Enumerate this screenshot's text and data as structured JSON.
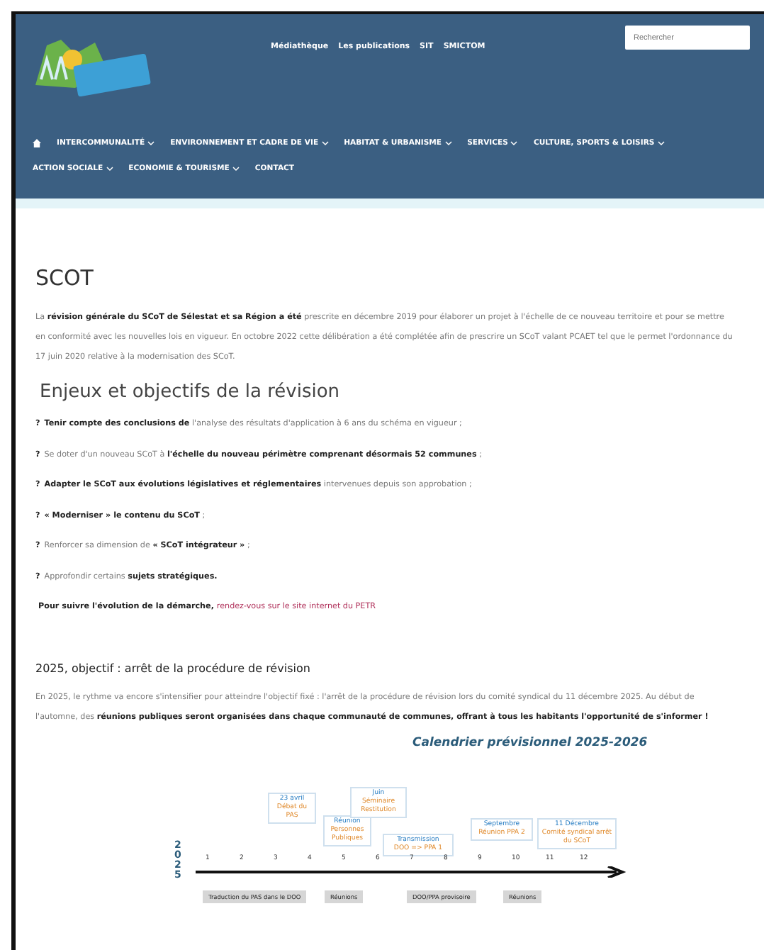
{
  "header": {
    "top_links": [
      "Médiathèque",
      "Les publications",
      "SIT",
      "SMICTOM"
    ],
    "search": {
      "placeholder": "Rechercher"
    },
    "nav": [
      {
        "label": "INTERCOMMUNALITÉ",
        "submenu": true
      },
      {
        "label": "ENVIRONNEMENT ET CADRE DE VIE",
        "submenu": true
      },
      {
        "label": "HABITAT & URBANISME",
        "submenu": true
      },
      {
        "label": "SERVICES",
        "submenu": true
      },
      {
        "label": "CULTURE, SPORTS & LOISIRS",
        "submenu": true
      },
      {
        "label": "ACTION SOCIALE",
        "submenu": true
      },
      {
        "label": "ECONOMIE & TOURISME",
        "submenu": true
      },
      {
        "label": "CONTACT",
        "submenu": false
      }
    ]
  },
  "page_title": "SCOT",
  "intro": "La **révision générale du SCoT de Sélestat et sa Région a été** prescrite en décembre 2019 pour élaborer un projet à l'échelle de ce nouveau territoire et pour se mettre en conformité avec les nouvelles lois en vigueur. En octobre 2022 cette délibération a été complétée afin de prescrire un SCoT valant PCAET tel que le permet l'ordonnance du 17 juin 2020 relative à la modernisation des SCoT.",
  "section_title": "Enjeux et objectifs de la révision",
  "objectives": [
    {
      "marker": "?",
      "text": "**Tenir compte des conclusions de** l'analyse des résultats d'application à 6 ans du schéma en vigueur ;"
    },
    {
      "marker": "?",
      "text": "Se doter d'un nouveau SCoT à **l'échelle du nouveau périmètre comprenant désormais 52 communes** ;"
    },
    {
      "marker": "?",
      "text": "**Adapter le SCoT aux évolutions législatives et réglementaires** intervenues depuis son approbation ;"
    },
    {
      "marker": "?",
      "text": "**« Moderniser » le contenu du SCoT** ;"
    },
    {
      "marker": "?",
      "text": "Renforcer sa dimension de **« SCoT intégrateur »** ;"
    },
    {
      "marker": "?",
      "text": "Approfondir certains **sujets stratégiques.**"
    }
  ],
  "follow": {
    "text": "Pour suivre l'évolution de la démarche,",
    "link": "rendez-vous sur le site internet du PETR"
  },
  "subsection_title": "2025, objectif : arrêt de la procédure de révision",
  "outlook": "En 2025, le rythme va encore s'intensifier pour atteindre l'objectif fixé : l'arrêt de la procédure de révision lors du comité syndical du 11 décembre 2025. Au début de l'automne, des **réunions publiques seront organisées dans chaque communauté de communes, offrant à tous les habitants l'opportunité de s'informer !**",
  "timeline": {
    "title": "Calendrier prévisionnel 2025-2026",
    "year": "2025",
    "months": [
      "1",
      "2",
      "3",
      "4",
      "5",
      "6",
      "7",
      "8",
      "9",
      "10",
      "11",
      "12"
    ],
    "events": [
      {
        "date": "23 avril",
        "label": "Débat du PAS"
      },
      {
        "date": "Réunion",
        "label": "Personnes Publiques"
      },
      {
        "date": "Juin",
        "label": "Séminaire Restitution"
      },
      {
        "date": "Transmission",
        "label": "DOO => PPA 1"
      },
      {
        "date": "Septembre",
        "label": "Réunion PPA 2"
      },
      {
        "date": "11 Décembre",
        "label": "Comité syndical arrêt du SCoT"
      }
    ],
    "phases": [
      "Traduction du PAS dans le DOO",
      "Réunions",
      "DOO/PPA provisoire",
      "Réunions"
    ]
  }
}
